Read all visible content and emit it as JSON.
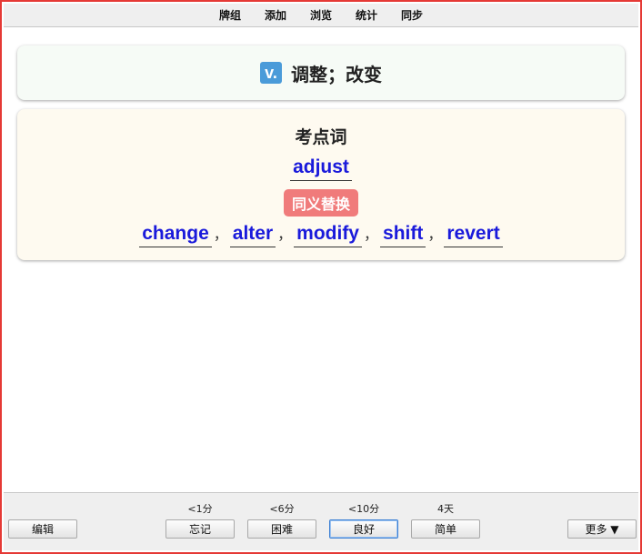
{
  "menu": {
    "items": [
      "牌组",
      "添加",
      "浏览",
      "统计",
      "同步"
    ]
  },
  "card": {
    "pos": "v.",
    "definition": "调整；改变",
    "exam_title": "考点词",
    "keyword": "adjust",
    "synonym_badge": "同义替换",
    "synonyms": [
      "change",
      "alter",
      "modify",
      "shift",
      "revert"
    ],
    "separator": "，"
  },
  "bottom": {
    "edit_label": "编辑",
    "more_label": "更多 ▼",
    "answers": [
      {
        "interval": "<1分",
        "label": "忘记"
      },
      {
        "interval": "<6分",
        "label": "困难"
      },
      {
        "interval": "<10分",
        "label": "良好"
      },
      {
        "interval": "4天",
        "label": "简单"
      }
    ]
  },
  "colors": {
    "window_border": "#e53935",
    "pos_badge": "#4a9bd9",
    "synonym_badge": "#f07b7b",
    "word_link": "#1a1adb"
  }
}
